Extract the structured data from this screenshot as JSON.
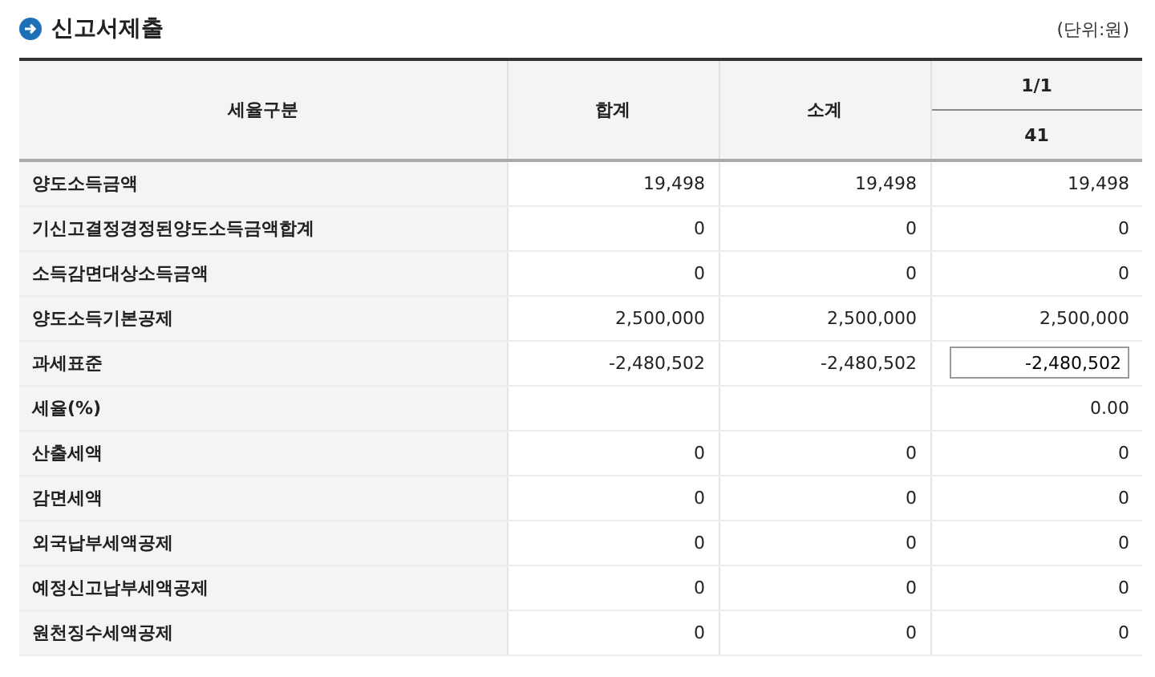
{
  "title": "신고서제출",
  "unit": "(단위:원)",
  "table": {
    "columns": [
      "세율구분",
      "합계",
      "소계"
    ],
    "group_header": "1/1",
    "sub_header": "41",
    "rows": [
      {
        "label": "양도소득금액",
        "total": "19,498",
        "subtotal": "19,498",
        "value": "19,498",
        "editable": false
      },
      {
        "label": "기신고결정경정된양도소득금액합계",
        "total": "0",
        "subtotal": "0",
        "value": "0",
        "editable": false
      },
      {
        "label": "소득감면대상소득금액",
        "total": "0",
        "subtotal": "0",
        "value": "0",
        "editable": false
      },
      {
        "label": "양도소득기본공제",
        "total": "2,500,000",
        "subtotal": "2,500,000",
        "value": "2,500,000",
        "editable": false
      },
      {
        "label": "과세표준",
        "total": "-2,480,502",
        "subtotal": "-2,480,502",
        "value": "-2,480,502",
        "editable": true
      },
      {
        "label": "세율(%)",
        "value": "0.00",
        "editable": false
      },
      {
        "label": "산출세액",
        "total": "0",
        "subtotal": "0",
        "value": "0",
        "editable": false
      },
      {
        "label": "감면세액",
        "total": "0",
        "subtotal": "0",
        "value": "0",
        "editable": false
      },
      {
        "label": "외국납부세액공제",
        "total": "0",
        "subtotal": "0",
        "value": "0",
        "editable": false
      },
      {
        "label": "예정신고납부세액공제",
        "total": "0",
        "subtotal": "0",
        "value": "0",
        "editable": false
      },
      {
        "label": "원천징수세액공제",
        "total": "0",
        "subtotal": "0",
        "value": "0",
        "editable": false
      }
    ]
  }
}
